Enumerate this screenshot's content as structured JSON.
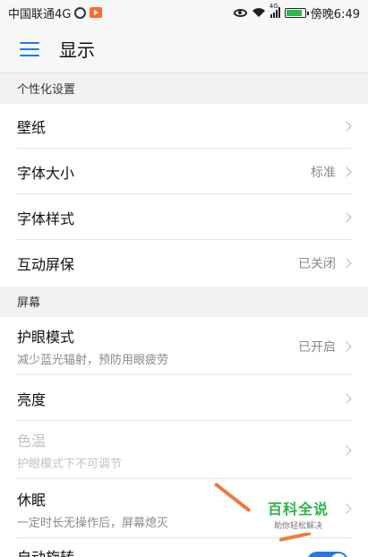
{
  "status_bar": {
    "carrier": "中国联通4G",
    "network_small": "4G",
    "time": "傍晚6:49",
    "battery_level": 0.85
  },
  "app_bar": {
    "title": "显示"
  },
  "sections": [
    {
      "header": "个性化设置",
      "items": [
        {
          "title": "壁纸",
          "value": "",
          "subtitle": ""
        },
        {
          "title": "字体大小",
          "value": "标准",
          "subtitle": ""
        },
        {
          "title": "字体样式",
          "value": "",
          "subtitle": ""
        },
        {
          "title": "互动屏保",
          "value": "已关闭",
          "subtitle": ""
        }
      ]
    },
    {
      "header": "屏幕",
      "items": [
        {
          "title": "护眼模式",
          "value": "已开启",
          "subtitle": "减少蓝光辐射，预防用眼疲劳"
        },
        {
          "title": "亮度",
          "value": "",
          "subtitle": ""
        },
        {
          "title": "色温",
          "value": "",
          "subtitle": "护眼模式下不可调节",
          "disabled": true
        },
        {
          "title": "休眠",
          "value": "",
          "subtitle": "一定时长无操作后，屏幕熄灭"
        },
        {
          "title": "自动旋转",
          "value": "",
          "subtitle": "",
          "toggle_on": true
        }
      ]
    }
  ],
  "watermark": {
    "title": "百科全说",
    "subtitle": "助你轻松解决"
  },
  "colors": {
    "accent": "#1f7be8",
    "watermark_green": "#2db34a",
    "arrow": "#f07a3a"
  }
}
